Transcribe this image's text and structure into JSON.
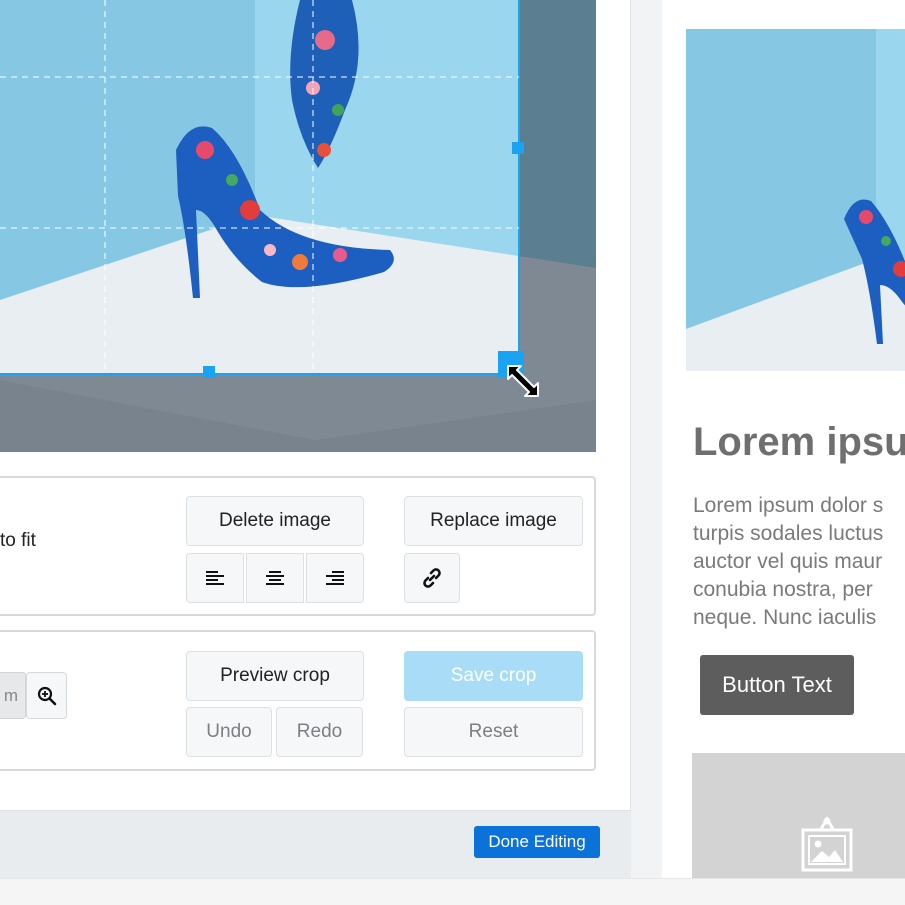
{
  "image_block": {
    "fit_label": "to fit",
    "delete_image": "Delete image",
    "replace_image": "Replace image",
    "align_icons": [
      "align-left-icon",
      "align-center-icon",
      "align-right-icon"
    ],
    "link_icon": "link-icon"
  },
  "crop": {
    "zoom_value": "m",
    "zoom_icon": "zoom-in-icon",
    "preview_crop": "Preview crop",
    "save_crop": "Save crop",
    "undo": "Undo",
    "redo": "Redo",
    "reset": "Reset"
  },
  "footer": {
    "done_editing": "Done Editing"
  },
  "preview": {
    "heading": "Lorem ipsu",
    "body_lines": [
      "Lorem ipsum dolor s",
      "turpis sodales luctus",
      "auctor vel quis maur",
      "conubia nostra, per",
      "neque. Nunc iaculis"
    ],
    "button_text": "Button Text",
    "placeholder_icon": "image-placeholder-icon"
  },
  "colors": {
    "accent": "#0a72d8",
    "crop_handle": "#1aa3f0",
    "save_disabled": "#a9ddf7",
    "preview_button": "#5d5d5d"
  }
}
